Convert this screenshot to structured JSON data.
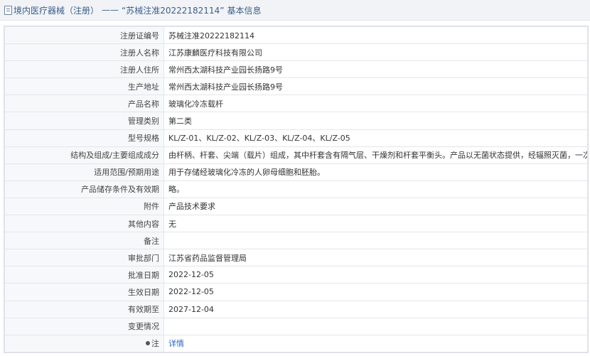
{
  "breadcrumb": {
    "icon": "document-icon",
    "root": "境内医疗器械（注册）",
    "separator": "——",
    "title": "“苏械注准20222182114”",
    "suffix": "基本信息"
  },
  "rows": [
    {
      "label": "注册证编号",
      "value": "苏械注准20222182114"
    },
    {
      "label": "注册人名称",
      "value": "江苏康麟医疗科技有限公司"
    },
    {
      "label": "注册人住所",
      "value": "常州西太湖科技产业园长扬路9号"
    },
    {
      "label": "生产地址",
      "value": "常州西太湖科技产业园长扬路9号"
    },
    {
      "label": "产品名称",
      "value": "玻璃化冷冻载杆"
    },
    {
      "label": "管理类别",
      "value": "第二类"
    },
    {
      "label": "型号规格",
      "value": "KL/Z-01、KL/Z-02、KL/Z-03、KL/Z-04、KL/Z-05"
    },
    {
      "label": "结构及组成/主要组成成分",
      "value": "由杆柄、杆套、尖端（载片）组成，其中杆套含有隔气层、干燥剂和杆套平衡头。产品以无菌状态提供，经辐照灭菌，一次性使用。"
    },
    {
      "label": "适用范围/预期用途",
      "value": "用于存储经玻璃化冷冻的人卵母细胞和胚胎。"
    },
    {
      "label": "产品储存条件及有效期",
      "value": "略。"
    },
    {
      "label": "附件",
      "value": "产品技术要求"
    },
    {
      "label": "其他内容",
      "value": "无"
    },
    {
      "label": "备注",
      "value": ""
    },
    {
      "label": "审批部门",
      "value": "江苏省药品监督管理局"
    },
    {
      "label": "批准日期",
      "value": "2022-12-05"
    },
    {
      "label": "生效日期",
      "value": "2022-12-05"
    },
    {
      "label": "有效期至",
      "value": "2027-12-04"
    },
    {
      "label": "变更情况",
      "value": ""
    }
  ],
  "note_row": {
    "label": "注",
    "icon": "pin-icon",
    "link": "详情"
  }
}
